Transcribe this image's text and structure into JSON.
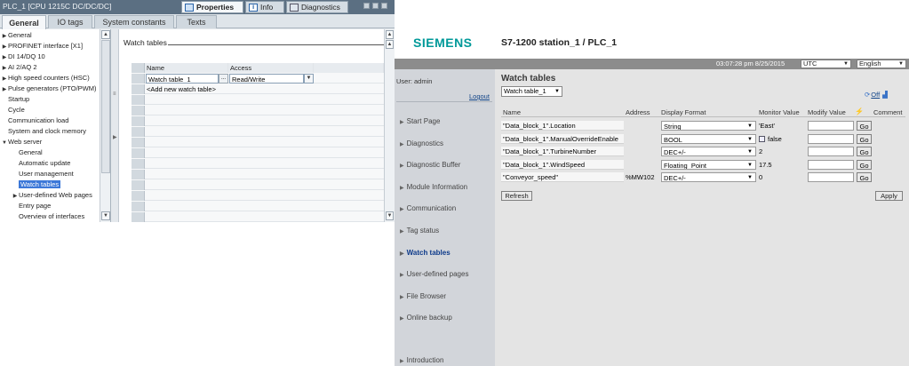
{
  "tia": {
    "title": "PLC_1 [CPU 1215C DC/DC/DC]",
    "inspector_tabs": {
      "properties": "Properties",
      "info": "Info",
      "diagnostics": "Diagnostics"
    },
    "section_tabs": [
      "General",
      "IO tags",
      "System constants",
      "Texts"
    ],
    "tree": [
      {
        "label": "General",
        "arrow": "▶",
        "indent": 0
      },
      {
        "label": "PROFINET interface [X1]",
        "arrow": "▶",
        "indent": 0
      },
      {
        "label": "DI 14/DQ 10",
        "arrow": "▶",
        "indent": 0
      },
      {
        "label": "AI 2/AQ 2",
        "arrow": "▶",
        "indent": 0
      },
      {
        "label": "High speed counters (HSC)",
        "arrow": "▶",
        "indent": 0
      },
      {
        "label": "Pulse generators (PTO/PWM)",
        "arrow": "▶",
        "indent": 0
      },
      {
        "label": "Startup",
        "arrow": "",
        "indent": 0
      },
      {
        "label": "Cycle",
        "arrow": "",
        "indent": 0
      },
      {
        "label": "Communication load",
        "arrow": "",
        "indent": 0
      },
      {
        "label": "System and clock memory",
        "arrow": "",
        "indent": 0
      },
      {
        "label": "Web server",
        "arrow": "▼",
        "indent": 0
      },
      {
        "label": "General",
        "arrow": "",
        "indent": 1
      },
      {
        "label": "Automatic update",
        "arrow": "",
        "indent": 1
      },
      {
        "label": "User management",
        "arrow": "",
        "indent": 1
      },
      {
        "label": "Watch tables",
        "arrow": "",
        "indent": 1,
        "selected": true
      },
      {
        "label": "User-defined Web pages",
        "arrow": "▶",
        "indent": 1
      },
      {
        "label": "Entry page",
        "arrow": "",
        "indent": 1
      },
      {
        "label": "Overview of interfaces",
        "arrow": "",
        "indent": 1
      }
    ],
    "section_title": "Watch tables",
    "grid": {
      "headers": [
        "Name",
        "Access"
      ],
      "name_value": "Watch table_1",
      "access_value": "Read/Write",
      "add_row": "<Add new watch table>"
    }
  },
  "web": {
    "brand": "SIEMENS",
    "station": "S7-1200 station_1 / PLC_1",
    "time": "03:07:28 pm  8/25/2015",
    "timezone": "UTC",
    "language": "English",
    "user": "User: admin",
    "logout": "Logout",
    "nav": [
      {
        "label": "Start Page"
      },
      {
        "label": "Diagnostics"
      },
      {
        "label": "Diagnostic Buffer"
      },
      {
        "label": "Module Information"
      },
      {
        "label": "Communication"
      },
      {
        "label": "Tag status"
      },
      {
        "label": "Watch tables",
        "active": true
      },
      {
        "label": "User-defined pages"
      },
      {
        "label": "File Browser"
      },
      {
        "label": "Online backup"
      },
      {
        "label": "Introduction"
      }
    ],
    "content_title": "Watch tables",
    "watch_table_select": "Watch table_1",
    "off_label": "Off",
    "columns": [
      "Name",
      "Address",
      "Display Format",
      "Monitor Value",
      "Modify Value",
      "Comment"
    ],
    "rows": [
      {
        "name": "\"Data_block_1\".Location",
        "address": "",
        "format": "String",
        "value": "'East'",
        "go": "Go"
      },
      {
        "name": "\"Data_block_1\".ManualOverrideEnable",
        "address": "",
        "format": "BOOL",
        "value": "false",
        "go": "Go",
        "checkbox": true
      },
      {
        "name": "\"Data_block_1\".TurbineNumber",
        "address": "",
        "format": "DEC+/-",
        "value": "2",
        "go": "Go"
      },
      {
        "name": "\"Data_block_1\".WindSpeed",
        "address": "",
        "format": "Floating_Point",
        "value": "17.5",
        "go": "Go"
      },
      {
        "name": "\"Conveyor_speed\"",
        "address": "%MW102",
        "format": "DEC+/-",
        "value": "0",
        "go": "Go"
      }
    ],
    "refresh": "Refresh",
    "apply": "Apply"
  }
}
